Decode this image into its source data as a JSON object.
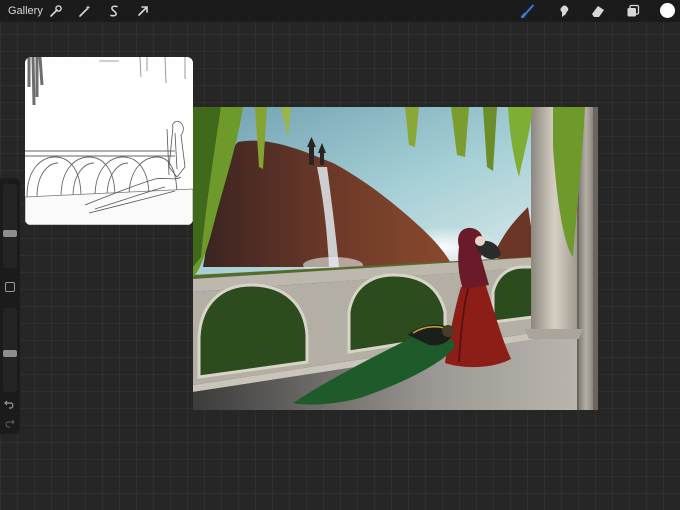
{
  "topbar": {
    "gallery_label": "Gallery",
    "left_tools": [
      "wrench-icon",
      "magic-wand-icon",
      "selection-icon",
      "transform-arrow-icon"
    ],
    "right_tools": [
      "brush-icon",
      "smudge-icon",
      "eraser-icon",
      "layers-icon"
    ],
    "active_tool": "brush-icon",
    "accent_color": "#3a7bd5",
    "current_color": "#ffffff"
  },
  "sidebar": {
    "brush_size_level": 0.6,
    "opacity_level": 0.55
  },
  "colors": {
    "background": "#262626",
    "sky": "#9fc9cf",
    "cliff": "#5a2f22",
    "waterfall": "#dfe9ec",
    "bridge": "#b7b3a7",
    "cloak_red": "#8c1e17",
    "cloak_green": "#1e5a2a",
    "column": "#cfc9bc",
    "ivy": "#6e9a2c"
  }
}
